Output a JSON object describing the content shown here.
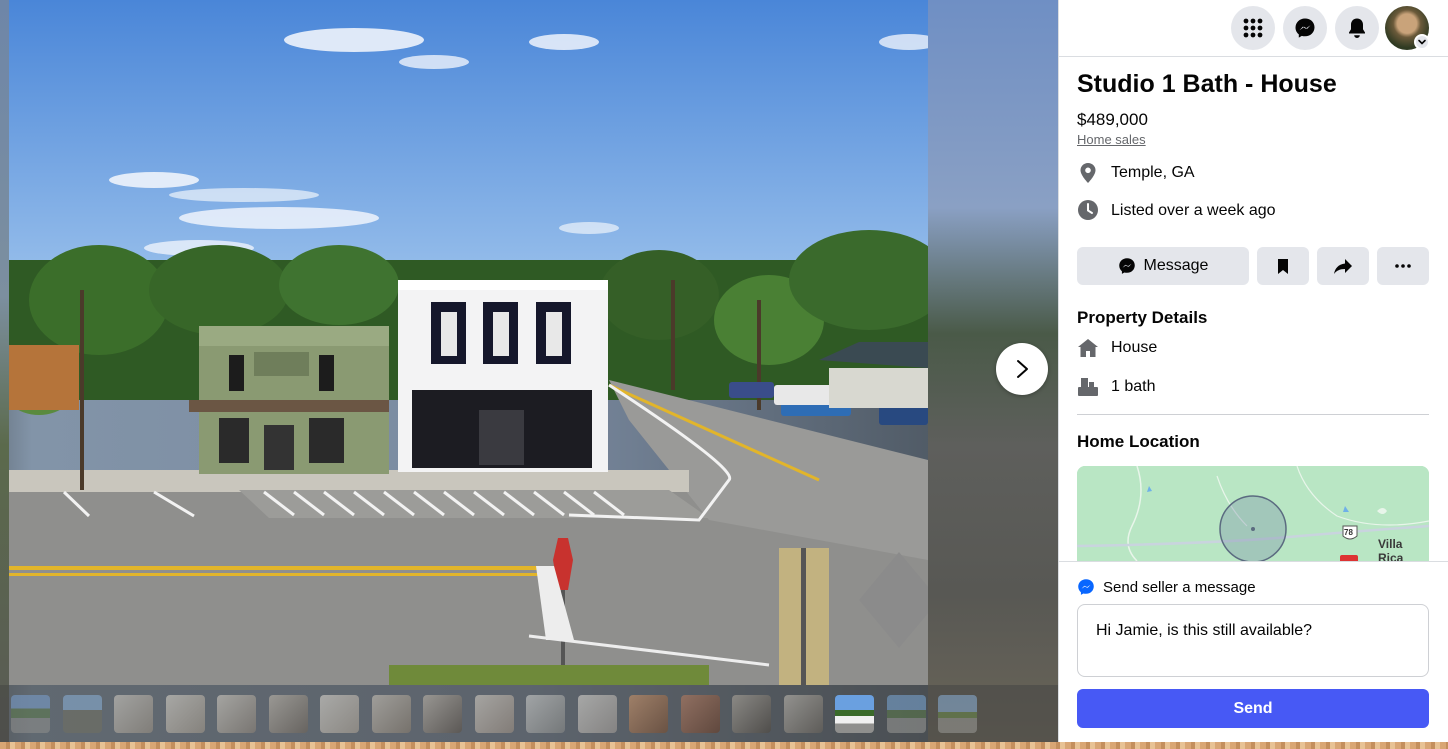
{
  "listing": {
    "title": "Studio 1 Bath - House",
    "price": "$489,000",
    "category": "Home sales",
    "location": "Temple, GA",
    "listed": "Listed over a week ago"
  },
  "actions": {
    "message_label": "Message",
    "save_icon": "bookmark-icon",
    "share_icon": "share-icon",
    "more_icon": "more-icon"
  },
  "property_details": {
    "heading": "Property Details",
    "type": "House",
    "baths": "1 bath"
  },
  "home_location": {
    "heading": "Home Location",
    "map_label": "Villa Rica",
    "route_badge": "78"
  },
  "seller_message": {
    "heading": "Send seller a message",
    "input_value": "Hi Jamie, is this still available?",
    "send_label": "Send"
  },
  "topbar": {
    "icons": [
      "menu-grid-icon",
      "messenger-icon",
      "notifications-icon",
      "account-avatar"
    ]
  },
  "gallery": {
    "thumbnail_count": 19,
    "active_index": 16
  },
  "colors": {
    "accent": "#4759f5",
    "button_bg": "#e4e6eb",
    "messenger": "#0866ff"
  }
}
